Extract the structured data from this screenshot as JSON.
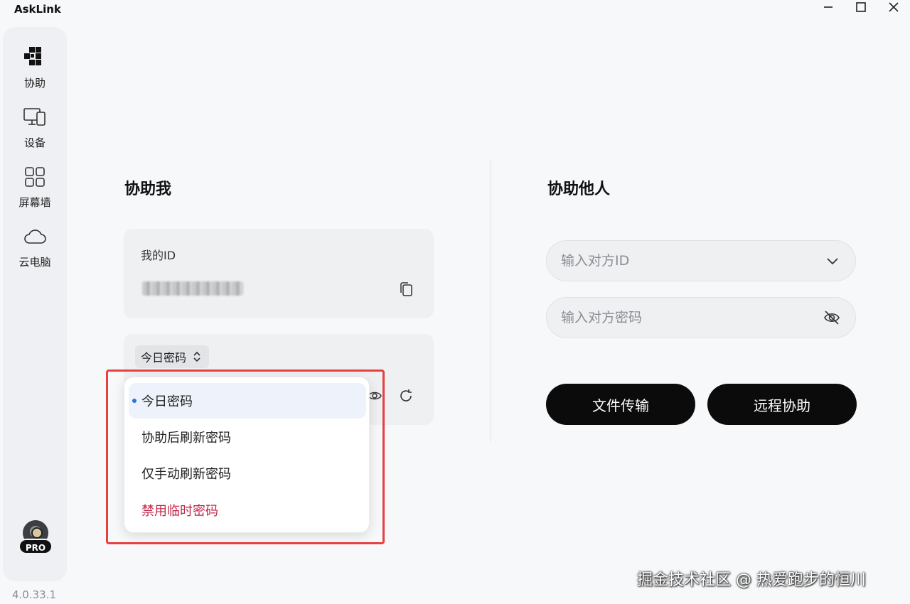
{
  "app": {
    "title": "AskLink",
    "version": "4.0.33.1"
  },
  "sidebar": {
    "items": [
      {
        "label": "协助",
        "icon": "assist-icon"
      },
      {
        "label": "设备",
        "icon": "devices-icon"
      },
      {
        "label": "屏幕墙",
        "icon": "screen-wall-icon"
      },
      {
        "label": "云电脑",
        "icon": "cloud-icon"
      }
    ],
    "pro_badge": "PRO"
  },
  "assist_me": {
    "title": "协助我",
    "my_id_label": "我的ID",
    "password_mode": "今日密码"
  },
  "assist_others": {
    "title": "协助他人",
    "id_placeholder": "输入对方ID",
    "password_placeholder": "输入对方密码",
    "file_transfer": "文件传输",
    "remote_assist": "远程协助"
  },
  "dropdown": {
    "options": [
      {
        "label": "今日密码",
        "selected": true
      },
      {
        "label": "协助后刷新密码",
        "selected": false
      },
      {
        "label": "仅手动刷新密码",
        "selected": false
      },
      {
        "label": "禁用临时密码",
        "selected": false,
        "danger": true
      }
    ]
  },
  "watermark": "掘金技术社区 @ 热爱跑步的恒川",
  "colors": {
    "accent": "#2f6fe0",
    "danger": "#c0284a",
    "highlight": "#e84040",
    "button": "#0b0b0b"
  }
}
